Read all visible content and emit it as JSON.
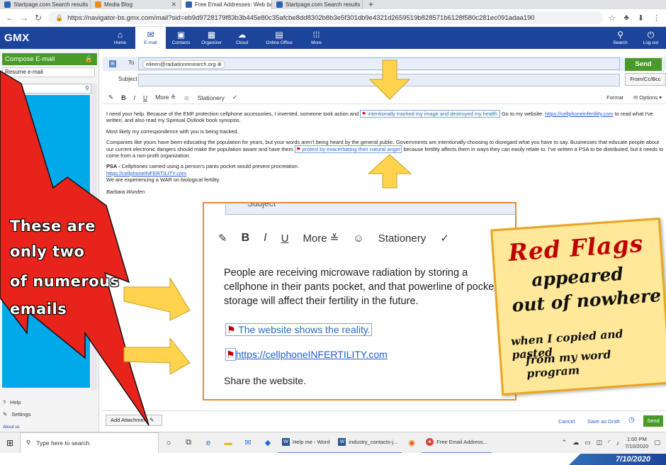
{
  "browser": {
    "tabs": [
      {
        "title": "Startpage.com Search results"
      },
      {
        "title": "Media Blog"
      },
      {
        "title": "Free Email Addresses: Web base"
      },
      {
        "title": "Startpage.com Search results"
      }
    ],
    "url": "https://navigator-bs.gmx.com/mail?sid=eb9d9728179f83b3b445e80c35afcbe8dd8302b8b3e5f301db9e4321d2659519b828571b6128f580c281ec091adaa190"
  },
  "gmx": {
    "logo": "GMX",
    "nav": [
      {
        "label": "Home",
        "icon": "home-icon"
      },
      {
        "label": "E-mail",
        "icon": "envelope-icon"
      },
      {
        "label": "Contacts",
        "icon": "contacts-icon"
      },
      {
        "label": "Organizer",
        "icon": "calendar-icon"
      },
      {
        "label": "Cloud",
        "icon": "cloud-icon"
      },
      {
        "label": "Online Office",
        "icon": "office-icon"
      },
      {
        "label": "More",
        "icon": "grid-icon"
      }
    ],
    "search_label": "Search",
    "logout_label": "Log out"
  },
  "sidebar": {
    "compose_label": "Compose E-mail",
    "resume_label": "Resume e-mail",
    "search_placeholder": "earch",
    "help_label": "Help",
    "settings_label": "Settings",
    "about_label": "About us"
  },
  "compose": {
    "to_label": "To",
    "to_value": "eileen@radiationresearch.org",
    "subject_label": "Subject",
    "send_label": "Send",
    "from_cc_label": "From/Cc/Bcc",
    "toolbar": {
      "more_label": "More",
      "stationery_label": "Stationery",
      "format_label": "Format",
      "options_label": "Options"
    },
    "body": {
      "p1_a": "I need your help. Because of the EMF protection cellphone accessories, I invented, someone took action and",
      "p1_flag": "intentionally trashed my image and destroyed my health.",
      "p1_b": "Go to my website:",
      "p1_link": "https://cellphoneinfertility.com",
      "p1_c": "to read what I've written, and also read my Spiritual Outlook book synopsis.",
      "p2": "Most likely my correspondence with you is being tracked.",
      "p3_a": "Companies like yours have been educating the population for years, but your words aren't being heard by the general public.  Governments are intentionally choosing to disregard what you have to say.  Businesses that educate people about our current electronic dangers should make the population aware and have them",
      "p3_flag": "protest by exacerbating their natural anger",
      "p3_b": "because fertility affects them in ways they can easily relate to. I've written a PSA to be distributed, but it needs to come from a non-profit organization.",
      "psa_label": "PSA -",
      "psa_text": "Cellphones carried using a person's pants pocket would prevent procreation.",
      "psa_link": "https://cellphoneINFERTILITY.com",
      "war": "We are experiencing a WAR on biological fertility.",
      "signature": "Barbara Wurden"
    },
    "add_attachment_label": "Add Attachment",
    "cancel_label": "Cancel",
    "save_draft_label": "Save as Draft",
    "send_small_label": "Send"
  },
  "inset": {
    "subject_fragment": "Subject",
    "more_label": "More",
    "stationery_label": "Stationery",
    "text": "People are receiving microwave radiation by storing a cellphone in their pants pocket, and that powerline of pocket storage will affect their fertility in the future.",
    "flag_line": "The website shows the reality.",
    "link_line": "https://cellphoneINFERTILITY.com",
    "share_line": "Share the website."
  },
  "note": {
    "line1": "Red Flags",
    "line2": "appeared",
    "line3": "out of nowhere",
    "line4": "when I copied and pasted",
    "line5": "from my word program"
  },
  "callout": {
    "line1": "These are",
    "line2": "only two",
    "line3": "of numerous",
    "line4": "emails"
  },
  "taskbar": {
    "search_placeholder": "Type here to search",
    "apps": [
      {
        "label": "Help me - Word"
      },
      {
        "label": "industry_contacts-j..."
      },
      {
        "label": "Free Email Address..."
      }
    ],
    "time": "1:00 PM",
    "date": "7/10/2020"
  },
  "date_badge": "7/10/2020",
  "colors": {
    "gmx_blue": "#1c449b",
    "send_green": "#4a9a2a",
    "callout_red": "#e8231b",
    "arrow_yellow": "#ffd34d",
    "note_yellow": "#ffe89a"
  }
}
